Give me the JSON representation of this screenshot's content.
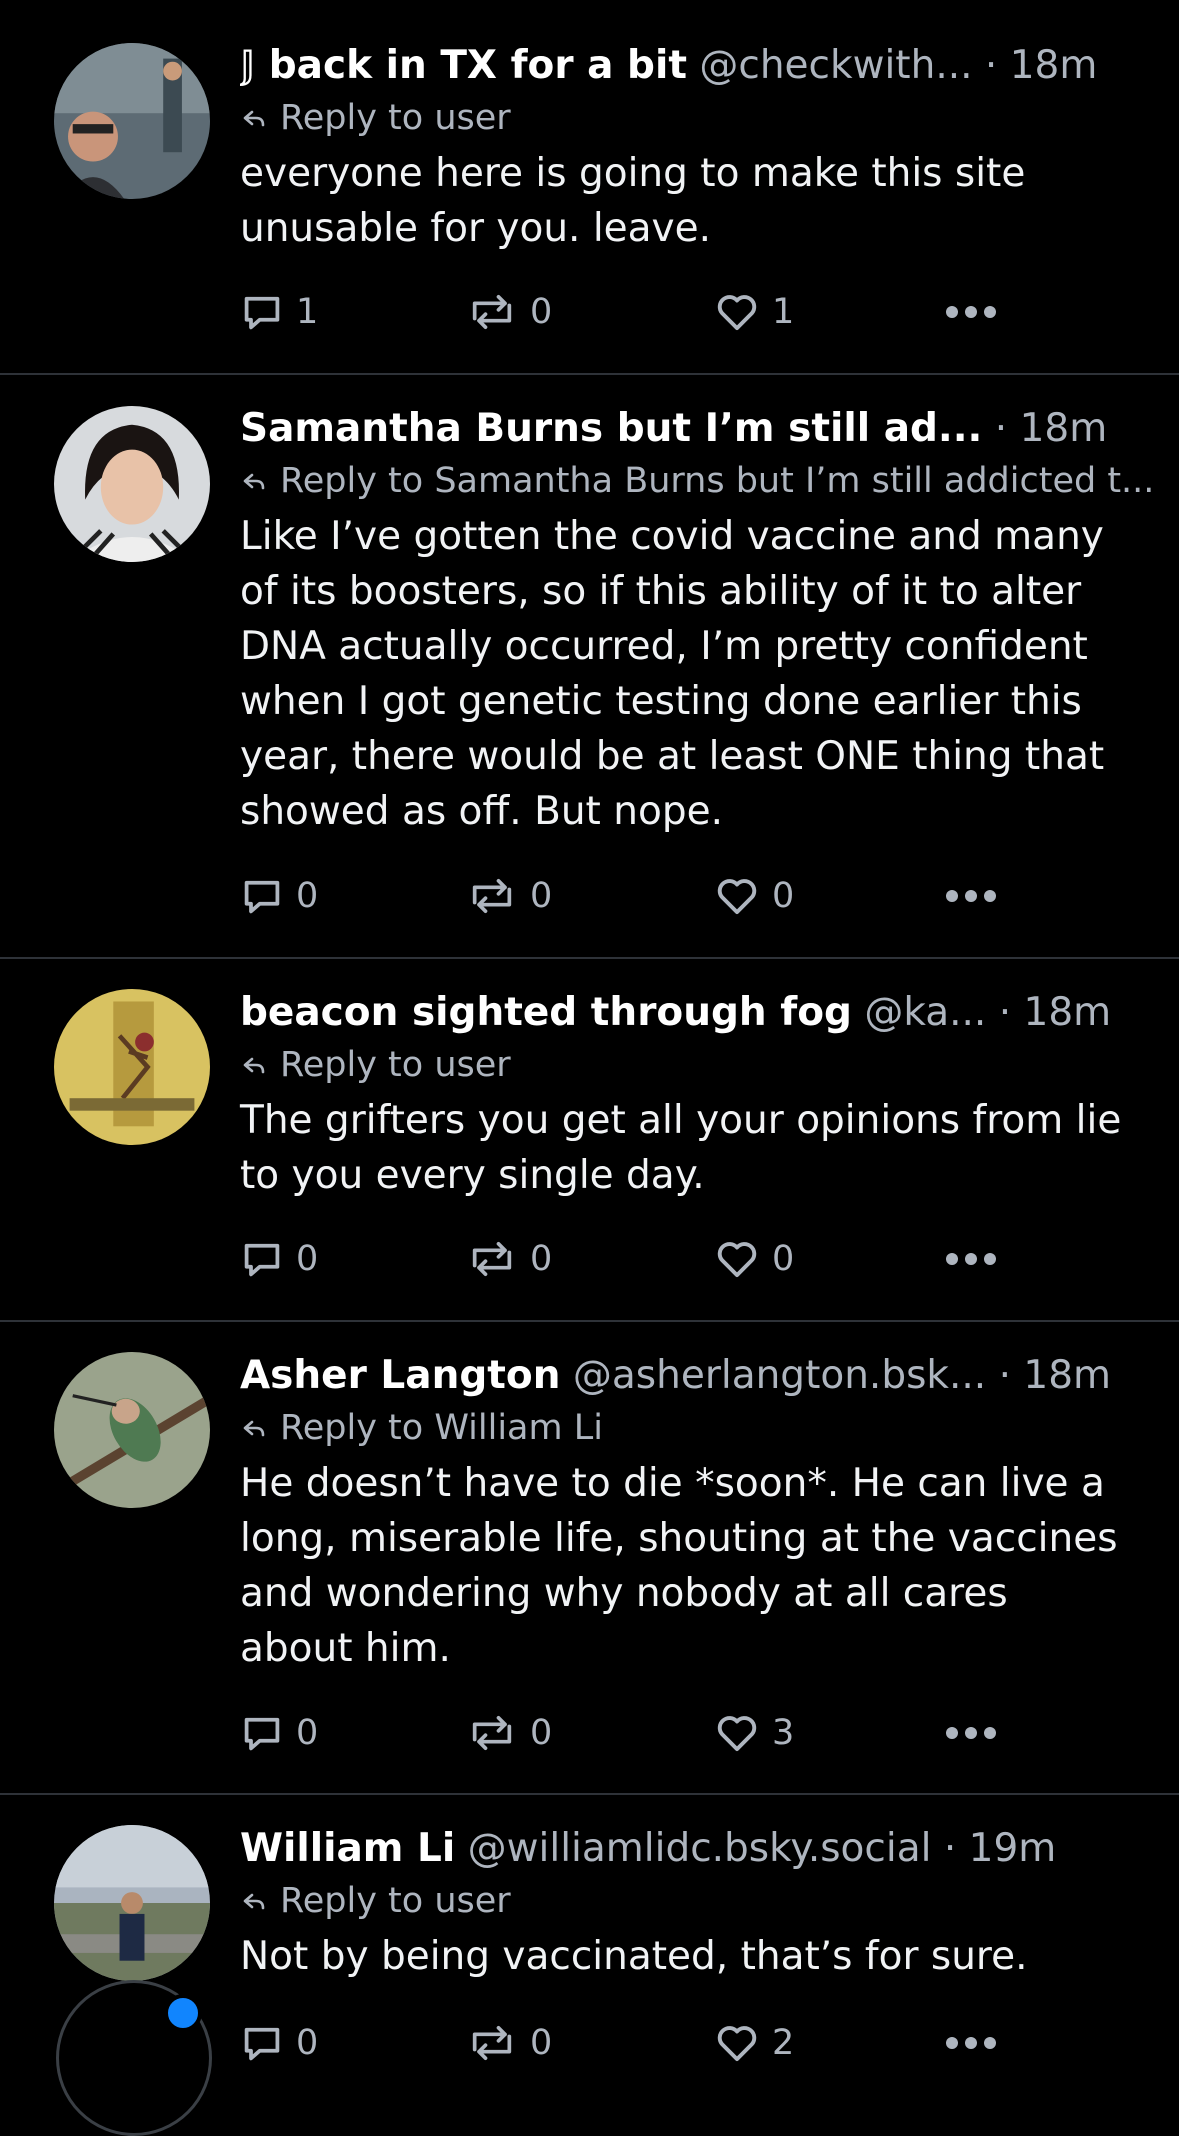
{
  "posts": [
    {
      "name": "𝕁 back in TX for a bit",
      "handle": "@checkwith...",
      "time": "· 18m",
      "reply_to": "Reply to user",
      "text": [
        "everyone here is going to make this site",
        "unusable for you. leave."
      ],
      "replies": "1",
      "reposts": "0",
      "likes": "1"
    },
    {
      "name": "Samantha Burns but I’m still ad...",
      "handle": "",
      "time": "· 18m",
      "reply_to": "Reply to Samantha Burns but I’m still addicted t...",
      "text": [
        "Like I’ve gotten the covid vaccine and many",
        "of its boosters, so if this ability of it to alter",
        "DNA actually occurred, I’m pretty confident",
        "when I got genetic testing done earlier this",
        "year, there would be at least ONE thing that",
        "showed as off. But nope."
      ],
      "replies": "0",
      "reposts": "0",
      "likes": "0"
    },
    {
      "name": "beacon sighted through fog",
      "handle": "@ka...",
      "time": "· 18m",
      "reply_to": "Reply to user",
      "text": [
        "The grifters you get all your opinions from lie",
        "to you every single day."
      ],
      "replies": "0",
      "reposts": "0",
      "likes": "0"
    },
    {
      "name": "Asher Langton",
      "handle": "@asherlangton.bsk...",
      "time": "· 18m",
      "reply_to": "Reply to William Li",
      "text": [
        "He doesn’t have to die *soon*. He can live a",
        "long, miserable life, shouting at the vaccines",
        "and wondering why nobody at all cares",
        "about him."
      ],
      "replies": "0",
      "reposts": "0",
      "likes": "3"
    },
    {
      "name": "William Li",
      "handle": "@williamlidc.bsky.social",
      "time": "· 19m",
      "reply_to": "Reply to user",
      "text": [
        "Not by being vaccinated, that’s for sure."
      ],
      "replies": "0",
      "reposts": "0",
      "likes": "2"
    }
  ],
  "icons": {
    "reply": "reply-arrow-icon",
    "comment": "comment-bubble-icon",
    "repost": "repost-icon",
    "like": "heart-icon",
    "more": "more-dots-icon"
  },
  "colors": {
    "background": "#000000",
    "muted": "#aeb5bf",
    "divider": "#2e3238",
    "accent": "#1185fe"
  }
}
